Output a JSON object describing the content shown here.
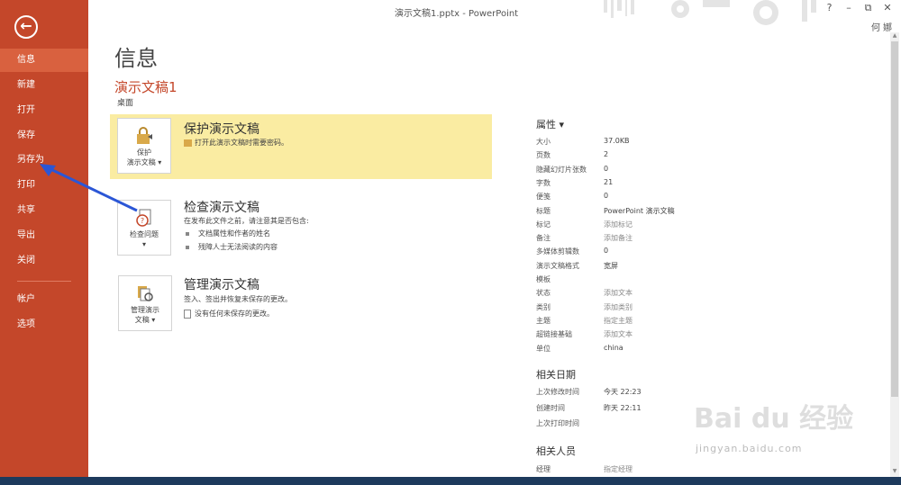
{
  "window": {
    "title": "演示文稿1.pptx - PowerPoint",
    "controls": [
      "?",
      "–",
      "⧉",
      "✕"
    ],
    "user": "何 娜"
  },
  "sidebar": {
    "back_icon": "back-arrow-icon",
    "items": [
      {
        "label": "信息",
        "active": true
      },
      {
        "label": "新建"
      },
      {
        "label": "打开"
      },
      {
        "label": "保存"
      },
      {
        "label": "另存为"
      },
      {
        "label": "打印"
      },
      {
        "label": "共享"
      },
      {
        "label": "导出"
      },
      {
        "label": "关闭"
      },
      {
        "label": "帐户"
      },
      {
        "label": "选项"
      }
    ]
  },
  "main": {
    "page_title": "信息",
    "doc_name": "演示文稿1",
    "doc_location": "桌面",
    "protect": {
      "button_line1": "保护",
      "button_line2": "演示文稿 ▾",
      "title": "保护演示文稿",
      "desc": "打开此演示文稿时需要密码。"
    },
    "inspect": {
      "button_line1": "检查问题",
      "button_line2": "▾",
      "title": "检查演示文稿",
      "desc": "在发布此文件之前，请注意其是否包含:",
      "bullets": [
        "文档属性和作者的姓名",
        "残障人士无法阅读的内容"
      ]
    },
    "manage": {
      "button_line1": "管理演示",
      "button_line2": "文稿 ▾",
      "title": "管理演示文稿",
      "desc": "签入、签出并恢复未保存的更改。",
      "note": "没有任何未保存的更改。"
    }
  },
  "properties": {
    "title": "属性 ▾",
    "rows": [
      {
        "k": "大小",
        "v": "37.0KB"
      },
      {
        "k": "页数",
        "v": "2"
      },
      {
        "k": "隐藏幻灯片张数",
        "v": "0"
      },
      {
        "k": "字数",
        "v": "21"
      },
      {
        "k": "便笺",
        "v": "0"
      },
      {
        "k": "标题",
        "v": "PowerPoint 演示文稿"
      },
      {
        "k": "标记",
        "v": "添加标记"
      },
      {
        "k": "备注",
        "v": "添加备注"
      },
      {
        "k": "多媒体剪辑数",
        "v": "0"
      },
      {
        "k": "演示文稿格式",
        "v": "宽屏"
      },
      {
        "k": "模板",
        "v": ""
      },
      {
        "k": "状态",
        "v": "添加文本"
      },
      {
        "k": "类别",
        "v": "添加类别"
      },
      {
        "k": "主题",
        "v": "指定主题"
      },
      {
        "k": "超链接基础",
        "v": "添加文本"
      },
      {
        "k": "单位",
        "v": "china"
      }
    ],
    "dates_title": "相关日期",
    "dates": [
      {
        "k": "上次修改时间",
        "v": "今天 22:23"
      },
      {
        "k": "创建时间",
        "v": "昨天 22:11"
      },
      {
        "k": "上次打印时间",
        "v": ""
      }
    ],
    "people_title": "相关人员",
    "people": [
      {
        "k": "经理",
        "v": "指定经理"
      }
    ]
  },
  "watermark": {
    "text": "Bai du 经验",
    "sub": "jingyan.baidu.com"
  }
}
